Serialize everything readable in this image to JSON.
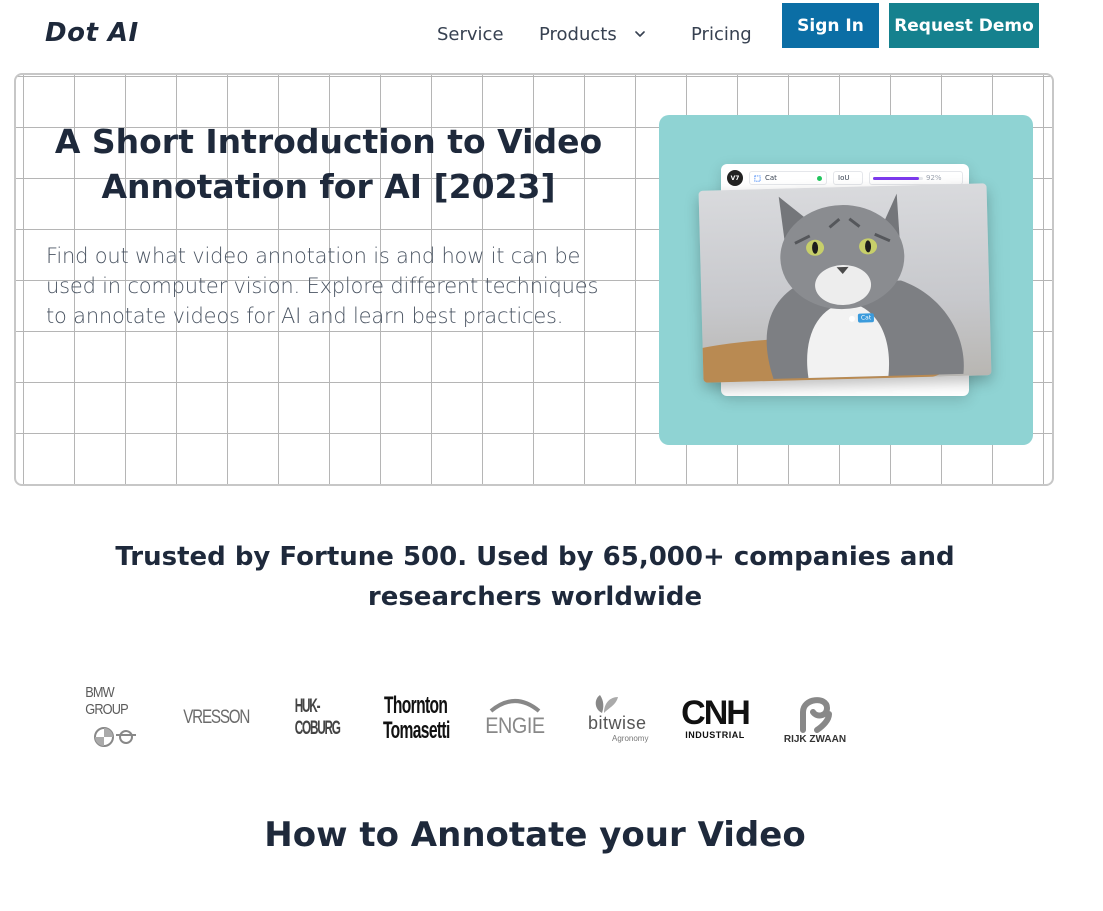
{
  "nav": {
    "logo": "Dot AI",
    "links": [
      "Service",
      "Products",
      "Pricing"
    ],
    "products_dropdown_icon": "chevron-down-icon",
    "sign_in": "Sign In",
    "request_demo": "Request Demo"
  },
  "hero": {
    "title": "A Short Introduction to Video Annotation for AI [2023]",
    "description": "Find out what video annotation is and how it can be used in computer vision. Explore different techniques to annotate videos for AI and learn best practices.",
    "visual": {
      "app_badge": "V7",
      "class_name": "Cat",
      "metric_label": "IoU",
      "score_text": "92%",
      "score_fraction": 0.92,
      "tag_label": "Cat"
    }
  },
  "trusted": {
    "heading": "Trusted by Fortune 500. Used by 65,000+ companies and researchers worldwide"
  },
  "logos": [
    {
      "name": "BMW GROUP"
    },
    {
      "name": "VRESSON"
    },
    {
      "name": "HUK-COBURG"
    },
    {
      "line1": "Thornton",
      "line2": "Tomasetti"
    },
    {
      "name": "ENGIE"
    },
    {
      "name": "bitwise",
      "sub": "Agronomy"
    },
    {
      "name": "CNH",
      "sub": "INDUSTRIAL"
    },
    {
      "name": "RIJK ZWAAN"
    }
  ],
  "section": {
    "heading": "How to Annotate your Video"
  },
  "colors": {
    "sign_in_bg": "#0b6ea5",
    "request_demo_bg": "#15818e",
    "visual_bg": "#8fd3d3",
    "heading": "#1e293b"
  }
}
